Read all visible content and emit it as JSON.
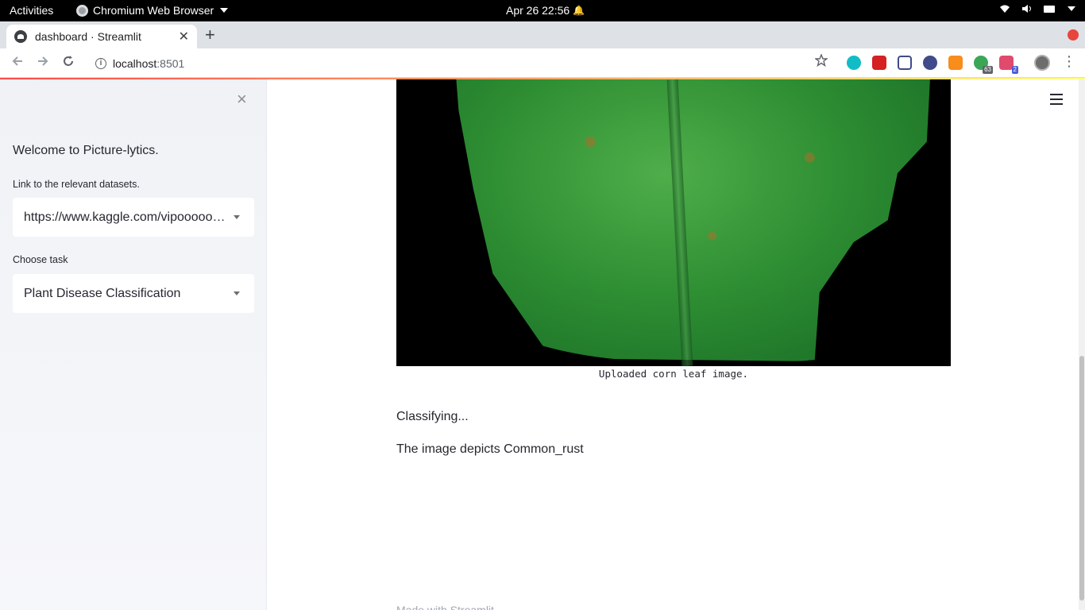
{
  "os_bar": {
    "activities": "Activities",
    "app_name": "Chromium Web Browser",
    "datetime": "Apr 26  22:56",
    "alarm_glyph": "🔔"
  },
  "browser": {
    "tab_title": "dashboard · Streamlit",
    "tab_close": "✕",
    "new_tab": "+",
    "url_host": "localhost",
    "url_port": ":8501",
    "ext_badge_1": "63",
    "ext_badge_2": "2",
    "colors": {
      "recording_dot": "#e8453c",
      "ext_teal": "#12bcc6",
      "ext_red": "#d42121",
      "ext_navy": "#3f4b8a",
      "ext_orange": "#f88d1b",
      "ext_green": "#3aa757",
      "ext_pink": "#e04b6d"
    }
  },
  "sidebar": {
    "close_glyph": "×",
    "welcome": "Welcome to Picture-lytics.",
    "datasets_label": "Link to the relevant datasets.",
    "datasets_value": "https://www.kaggle.com/vipoooooo...",
    "task_label": "Choose task",
    "task_value": "Plant Disease Classification"
  },
  "main": {
    "image_caption": "Uploaded corn leaf image.",
    "status_text": "Classifying...",
    "result_text": "The image depicts Common_rust",
    "footer_partial": "Made with Streamlit"
  },
  "theme": {
    "primary": "#ff4b4b",
    "sidebar_bg": "#f0f2f6",
    "text": "#262730"
  }
}
